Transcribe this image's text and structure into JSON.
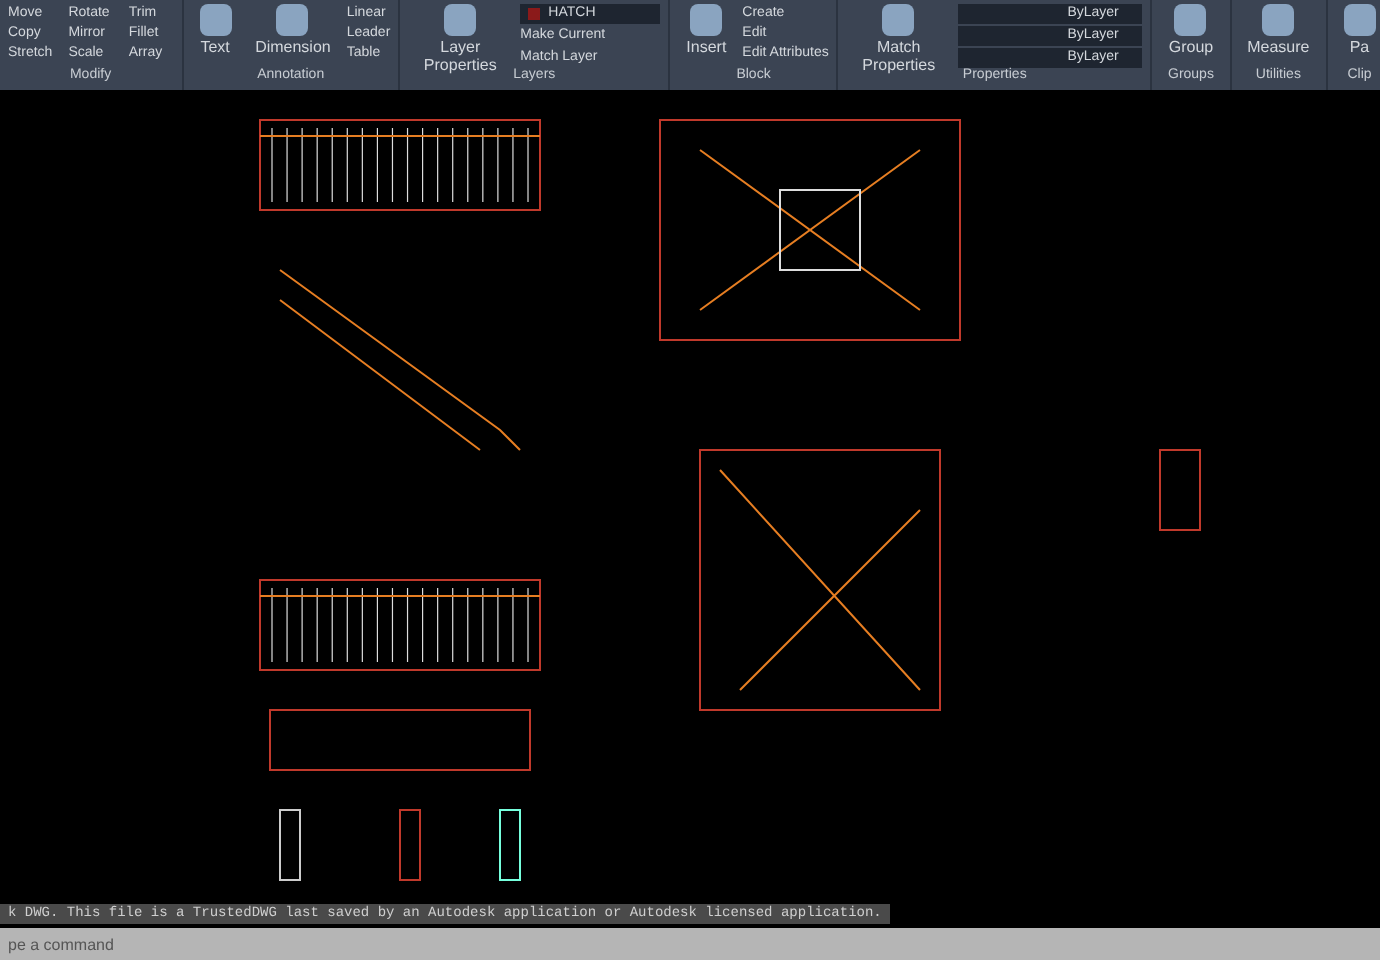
{
  "ribbon": {
    "panels": [
      {
        "title": "Modify",
        "tools": [
          "Move",
          "Rotate",
          "Trim",
          "Copy",
          "Mirror",
          "Fillet",
          "Stretch",
          "Scale",
          "Array"
        ]
      },
      {
        "title": "Annotation",
        "big": [
          "Text",
          "Dimension"
        ],
        "tools": [
          "Linear",
          "Leader",
          "Table"
        ]
      },
      {
        "title": "Layers",
        "big": [
          "Layer Properties"
        ],
        "layer": "HATCH",
        "tools": [
          "Make Current",
          "Match Layer"
        ]
      },
      {
        "title": "Block",
        "big": [
          "Insert"
        ],
        "tools": [
          "Create",
          "Edit",
          "Edit Attributes"
        ]
      },
      {
        "title": "Properties",
        "big": [
          "Match Properties"
        ],
        "props": [
          "ByLayer",
          "ByLayer",
          "ByLayer"
        ]
      },
      {
        "title": "Groups",
        "big": [
          "Group"
        ]
      },
      {
        "title": "Utilities",
        "big": [
          "Measure"
        ]
      },
      {
        "title": "Clip",
        "big": [
          "Pa"
        ]
      }
    ]
  },
  "command_history": "k DWG.  This file is a TrustedDWG last saved by an Autodesk application or Autodesk licensed application.",
  "command_line": {
    "placeholder": "pe a command"
  }
}
